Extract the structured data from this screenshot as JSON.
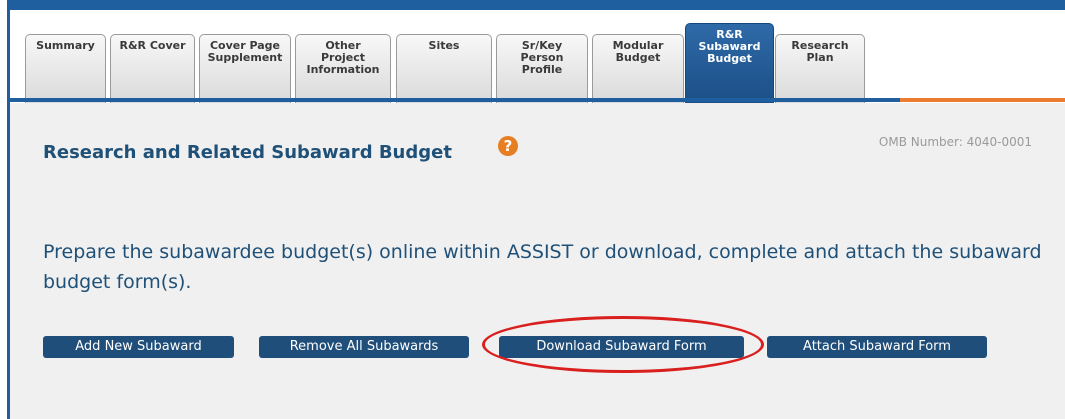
{
  "tabs": [
    {
      "id": "summary",
      "label": "Summary",
      "active": false
    },
    {
      "id": "rr-cover",
      "label": "R&R Cover",
      "active": false
    },
    {
      "id": "cover-page-supplement",
      "label": "Cover Page\nSupplement",
      "active": false
    },
    {
      "id": "other-project-information",
      "label": "Other\nProject\nInformation",
      "active": false
    },
    {
      "id": "sites",
      "label": "Sites",
      "active": false
    },
    {
      "id": "sr-key-person-profile",
      "label": "Sr/Key\nPerson\nProfile",
      "active": false
    },
    {
      "id": "modular-budget",
      "label": "Modular\nBudget",
      "active": false
    },
    {
      "id": "rr-subaward-budget",
      "label": "R&R\nSubaward\nBudget",
      "active": true
    },
    {
      "id": "research-plan",
      "label": "Research\nPlan",
      "active": false
    }
  ],
  "page": {
    "title": "Research and Related Subaward Budget",
    "help_icon": "question-circle-icon",
    "help_glyph": "?",
    "omb_number": "OMB Number: 4040-0001",
    "instructions": "Prepare the subawardee budget(s) online within ASSIST or download, complete and attach the subaward budget form(s)."
  },
  "buttons": {
    "add_new": "Add New Subaward",
    "remove_all": "Remove All Subawards",
    "download_form": "Download Subaward Form",
    "attach_form": "Attach Subaward Form"
  },
  "colors": {
    "frame_blue": "#1f5fa0",
    "accent_orange": "#ec7c30",
    "button_bg": "#1f4e7a",
    "title_text": "#1f5078",
    "highlight_red": "#d9201f"
  }
}
